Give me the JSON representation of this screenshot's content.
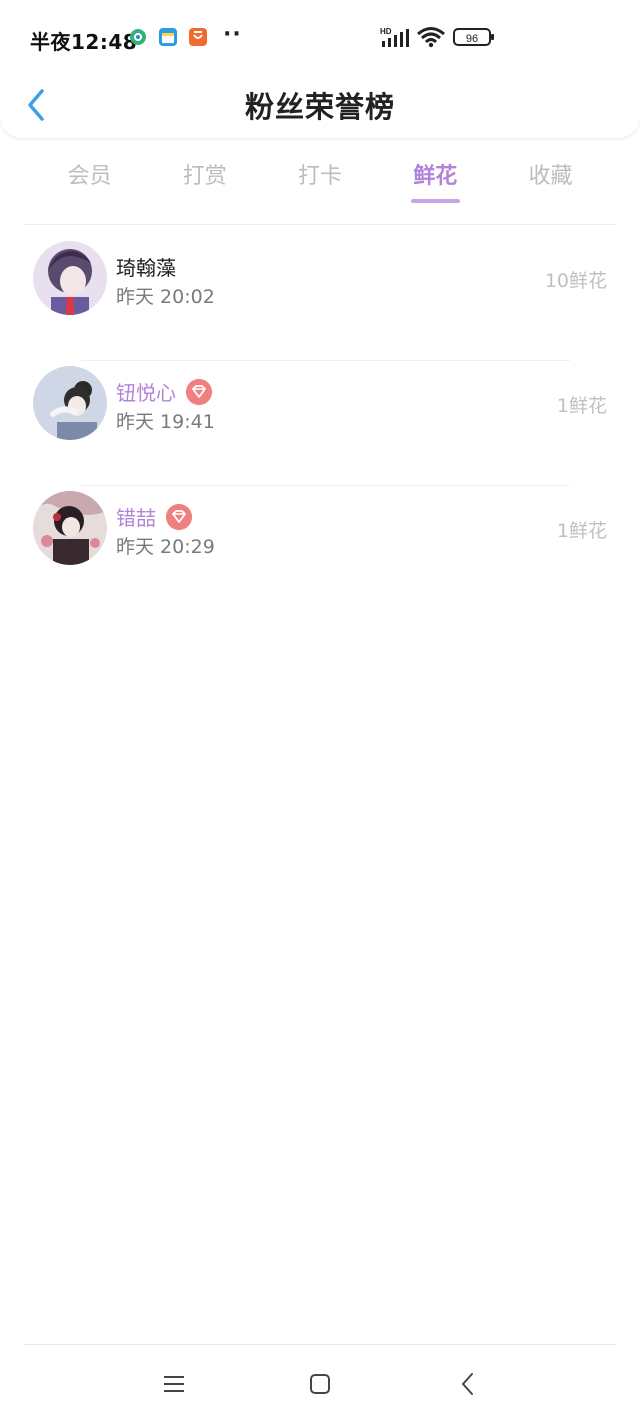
{
  "status_bar": {
    "time": "半夜12:48",
    "battery": "96",
    "network_label": "HD",
    "dots": "··"
  },
  "header": {
    "title": "粉丝荣誉榜"
  },
  "tabs": [
    {
      "label": "会员",
      "active": false
    },
    {
      "label": "打赏",
      "active": false
    },
    {
      "label": "打卡",
      "active": false
    },
    {
      "label": "鲜花",
      "active": true
    },
    {
      "label": "收藏",
      "active": false
    }
  ],
  "fans": [
    {
      "name": "琦翰藻",
      "time": "昨天 20:02",
      "count": "10鲜花",
      "vip": false
    },
    {
      "name": "钮悦心",
      "time": "昨天 19:41",
      "count": "1鲜花",
      "vip": true
    },
    {
      "name": "错喆",
      "time": "昨天 20:29",
      "count": "1鲜花",
      "vip": true
    }
  ],
  "colors": {
    "accent": "#b283d8",
    "back_arrow": "#3aa0e8",
    "vip_badge": "#f08080"
  },
  "icons": {
    "back": "back-arrow-icon",
    "vip": "diamond-badge-icon",
    "nav": [
      "menu-icon",
      "home-icon",
      "back-icon"
    ]
  }
}
